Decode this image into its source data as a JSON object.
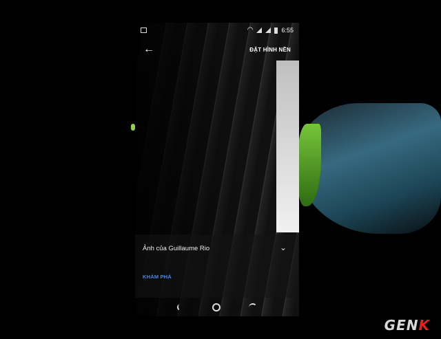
{
  "status": {
    "time": "6:55"
  },
  "toolbar": {
    "set_wallpaper_label": "ĐẶT HÌNH NỀN"
  },
  "photo": {
    "credit": "Ảnh của Guillaume Rio",
    "explore_label": "KHÁM PHÁ"
  },
  "logo": {
    "text_main": "GEN",
    "text_k": "K"
  },
  "icons": [
    "image-icon",
    "wifi-icon",
    "signal-icon",
    "battery-icon",
    "back-arrow-icon",
    "chevron-down-icon",
    "nav-back-icon",
    "nav-home-icon",
    "nav-recents-icon"
  ],
  "colors": {
    "accent": "#4a86e0",
    "logo_red": "#e0221b"
  }
}
